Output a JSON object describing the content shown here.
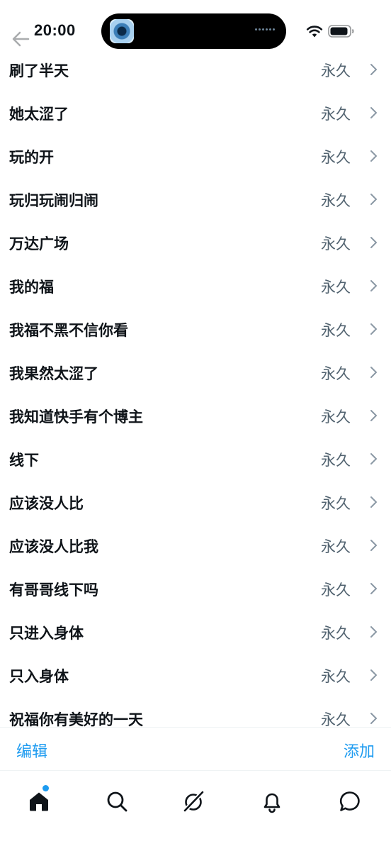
{
  "status_bar": {
    "time": "20:00"
  },
  "list": {
    "items": [
      {
        "label": "刷了半天",
        "value": "永久"
      },
      {
        "label": "她太涩了",
        "value": "永久"
      },
      {
        "label": "玩的开",
        "value": "永久"
      },
      {
        "label": "玩归玩闹归闹",
        "value": "永久"
      },
      {
        "label": "万达广场",
        "value": "永久"
      },
      {
        "label": "我的福",
        "value": "永久"
      },
      {
        "label": "我福不黑不信你看",
        "value": "永久"
      },
      {
        "label": "我果然太涩了",
        "value": "永久"
      },
      {
        "label": "我知道快手有个博主",
        "value": "永久"
      },
      {
        "label": "线下",
        "value": "永久"
      },
      {
        "label": "应该没人比",
        "value": "永久"
      },
      {
        "label": "应该没人比我",
        "value": "永久"
      },
      {
        "label": "有哥哥线下吗",
        "value": "永久"
      },
      {
        "label": "只进入身体",
        "value": "永久"
      },
      {
        "label": "只入身体",
        "value": "永久"
      },
      {
        "label": "祝福你有美好的一天",
        "value": "永久"
      }
    ]
  },
  "action_bar": {
    "edit_label": "编辑",
    "add_label": "添加"
  },
  "tab_bar": {
    "tabs": [
      {
        "name": "home",
        "icon": "home-icon",
        "active": true,
        "has_notification_dot": true
      },
      {
        "name": "search",
        "icon": "search-icon"
      },
      {
        "name": "grok",
        "icon": "grok-icon"
      },
      {
        "name": "notifications",
        "icon": "bell-icon"
      },
      {
        "name": "messages",
        "icon": "chat-bubble-icon"
      }
    ]
  },
  "colors": {
    "accent": "#1d9bf0",
    "text_primary": "#0f1419",
    "text_secondary": "#536471",
    "chevron": "#8b98a5"
  }
}
